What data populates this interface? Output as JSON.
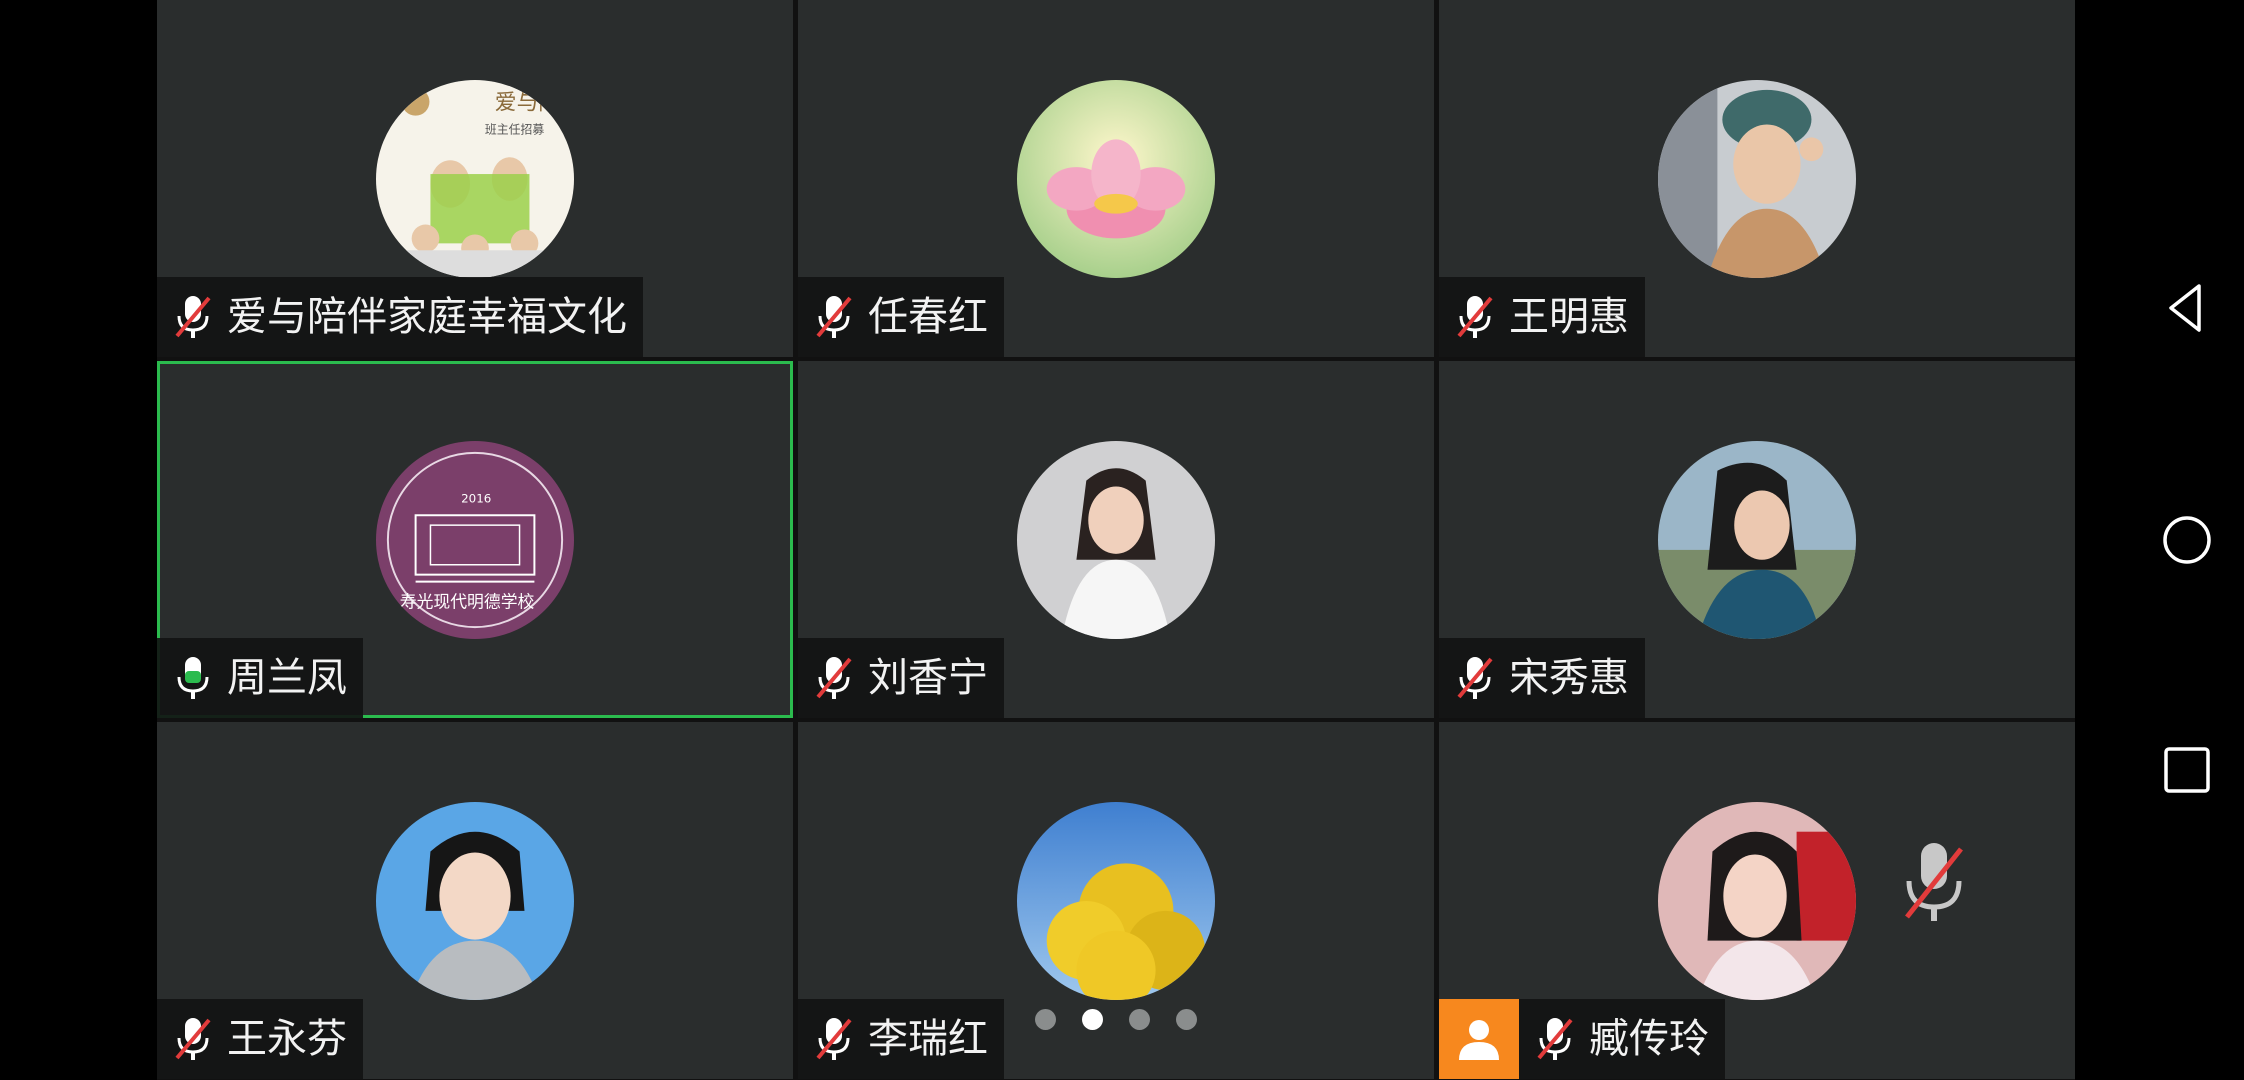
{
  "participants": [
    {
      "name": "爱与陪伴家庭幸福文化",
      "mic": "muted",
      "avatar_icon": "poster-avatar"
    },
    {
      "name": "任春红",
      "mic": "muted",
      "avatar_icon": "lotus-avatar"
    },
    {
      "name": "王明惠",
      "mic": "muted",
      "avatar_icon": "photo-avatar"
    },
    {
      "name": "周兰凤",
      "mic": "on",
      "avatar_icon": "school-logo-avatar"
    },
    {
      "name": "刘香宁",
      "mic": "muted",
      "avatar_icon": "photo-avatar"
    },
    {
      "name": "宋秀惠",
      "mic": "muted",
      "avatar_icon": "photo-avatar"
    },
    {
      "name": "王永芬",
      "mic": "muted",
      "avatar_icon": "photo-avatar"
    },
    {
      "name": "李瑞红",
      "mic": "muted",
      "avatar_icon": "tree-avatar"
    },
    {
      "name": "臧传玲",
      "mic": "muted",
      "avatar_icon": "photo-avatar",
      "is_self": true
    }
  ],
  "pager": {
    "pages": 4,
    "current": 2
  },
  "colors": {
    "tile_bg": "#2a2d2d",
    "active_border": "#2bbb4e",
    "muted_red": "#e23b3b",
    "host_badge": "#f7881e"
  },
  "navbar": {
    "icons": [
      "back-icon",
      "home-icon",
      "recents-icon"
    ]
  }
}
